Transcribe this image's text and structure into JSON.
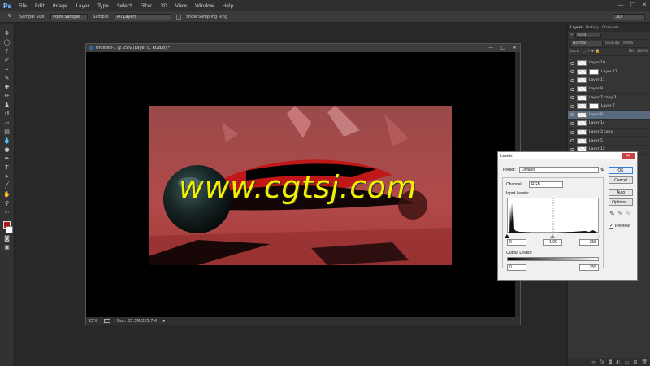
{
  "app": {
    "logo": "Ps"
  },
  "menu": [
    "File",
    "Edit",
    "Image",
    "Layer",
    "Type",
    "Select",
    "Filter",
    "3D",
    "View",
    "Window",
    "Help"
  ],
  "window_controls": [
    "—",
    "□",
    "✕"
  ],
  "options_bar": {
    "sample_size_label": "Sample Size:",
    "sample_size_value": "Point Sample",
    "sample_label": "Sample:",
    "sample_value": "All Layers",
    "show_ring_label": "Show Sampling Ring",
    "workspace": "3D"
  },
  "document": {
    "title": "Untitled-1 @ 25% (Layer 8, RGB/8) *",
    "zoom": "25%",
    "doc_size": "Doc: 35.3M/225.7M"
  },
  "watermark": "www.cgtsj.com",
  "layers_panel": {
    "tabs": [
      "Layers",
      "History",
      "Channels"
    ],
    "kind_filter": "Kind",
    "blend_mode": "Normal",
    "opacity_label": "Opacity:",
    "opacity_value": "100%",
    "lock_label": "Lock:",
    "fill_label": "Fill:",
    "fill_value": "100%",
    "layers": [
      {
        "name": "Layer 10",
        "mask": false,
        "selected": false
      },
      {
        "name": "Layer 12",
        "mask": true,
        "selected": false
      },
      {
        "name": "Layer 11",
        "mask": false,
        "selected": false
      },
      {
        "name": "Layer 9",
        "mask": false,
        "selected": false
      },
      {
        "name": "Layer 7 copy 3",
        "mask": false,
        "selected": false
      },
      {
        "name": "Layer 7",
        "mask": true,
        "selected": false
      },
      {
        "name": "Layer 8",
        "mask": false,
        "selected": true
      },
      {
        "name": "Layer 14",
        "mask": false,
        "selected": false
      },
      {
        "name": "Layer 3 copy",
        "mask": false,
        "selected": false
      },
      {
        "name": "Layer 5",
        "mask": false,
        "selected": false
      },
      {
        "name": "Layer 12",
        "mask": false,
        "selected": false
      }
    ]
  },
  "levels_dialog": {
    "title": "Levels",
    "preset_label": "Preset:",
    "preset_value": "Default",
    "channel_label": "Channel:",
    "channel_value": "RGB",
    "input_levels_label": "Input Levels:",
    "input_black": "0",
    "input_gamma": "1.00",
    "input_white": "255",
    "output_levels_label": "Output Levels:",
    "output_black": "0",
    "output_white": "255",
    "buttons": {
      "ok": "OK",
      "cancel": "Cancel",
      "auto": "Auto",
      "options": "Options..."
    },
    "preview_label": "Preview",
    "preview_checked": true
  }
}
